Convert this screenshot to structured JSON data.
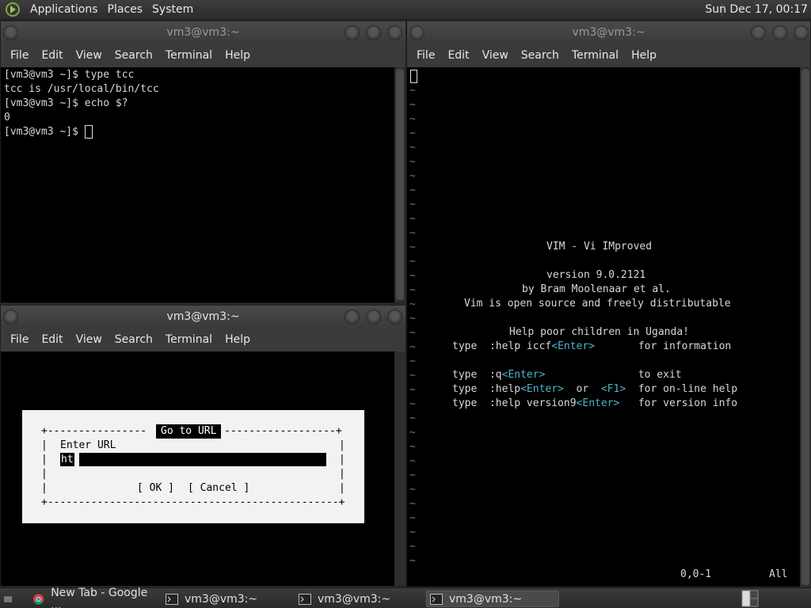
{
  "top_panel": {
    "menus": [
      "Applications",
      "Places",
      "System"
    ],
    "clock": "Sun Dec 17, 00:17"
  },
  "windows": {
    "top_left": {
      "title": "vm3@vm3:~",
      "menu": [
        "File",
        "Edit",
        "View",
        "Search",
        "Terminal",
        "Help"
      ],
      "lines": [
        "[vm3@vm3 ~]$ type tcc",
        "tcc is /usr/local/bin/tcc",
        "[vm3@vm3 ~]$ echo $?",
        "0",
        "[vm3@vm3 ~]$ "
      ]
    },
    "bottom_left": {
      "title": "vm3@vm3:~",
      "menu": [
        "File",
        "Edit",
        "View",
        "Search",
        "Terminal",
        "Help"
      ],
      "dialog": {
        "title": "Go to URL",
        "label": "Enter URL",
        "value": "ht",
        "ok": "[ OK ]",
        "cancel": "[ Cancel ]",
        "border_top_left": "+----------------",
        "border_top_right": "------------------+",
        "border_bottom": "+-----------------------------------------------+",
        "side": "|"
      }
    },
    "right": {
      "title": "vm3@vm3:~",
      "menu": [
        "File",
        "Edit",
        "View",
        "Search",
        "Terminal",
        "Help"
      ],
      "vim": {
        "tilde": "~",
        "splash_title": "VIM - Vi IMproved",
        "version": "version 9.0.2121",
        "author": "by Bram Moolenaar et al.",
        "license": "Vim is open source and freely distributable",
        "charity": "Help poor children in Uganda!",
        "help_rows": [
          {
            "pre": "type  :help iccf",
            "key": "<Enter>",
            "mid": "",
            "key2": "",
            "post": "       for information"
          },
          {
            "pre": "type  :q",
            "key": "<Enter>",
            "mid": "",
            "key2": "",
            "post": "               to exit"
          },
          {
            "pre": "type  :help",
            "key": "<Enter>",
            "mid": "  or  ",
            "key2": "<F1>",
            "post": "  for on-line help"
          },
          {
            "pre": "type  :help version9",
            "key": "<Enter>",
            "mid": "",
            "key2": "",
            "post": "   for version info"
          }
        ],
        "ruler_pos": "0,0-1",
        "ruler_all": "All"
      }
    }
  },
  "taskbar": {
    "tasks": [
      {
        "label": "New Tab - Google ...",
        "icon": "chrome-icon",
        "active": false
      },
      {
        "label": "vm3@vm3:~",
        "icon": "terminal-icon",
        "active": false
      },
      {
        "label": "vm3@vm3:~",
        "icon": "terminal-icon",
        "active": false
      },
      {
        "label": "vm3@vm3:~",
        "icon": "terminal-icon",
        "active": true
      }
    ]
  }
}
